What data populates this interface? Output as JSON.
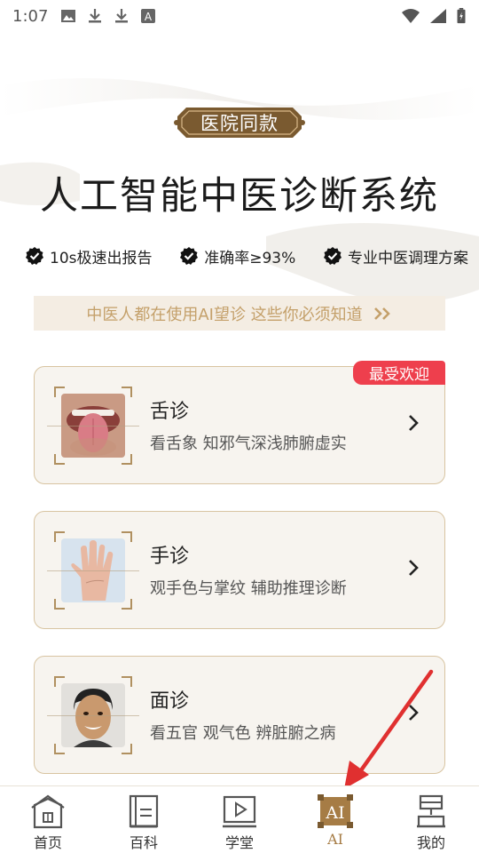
{
  "status_bar": {
    "time": "1:07",
    "left_icons": [
      "image-icon",
      "download-icon",
      "download-icon",
      "font-icon"
    ],
    "right_icons": [
      "wifi-icon",
      "signal-icon",
      "battery-icon"
    ]
  },
  "header": {
    "badge": "医院同款",
    "title": "人工智能中医诊断系统",
    "features": [
      {
        "icon": "check-icon",
        "label": "10s极速出报告"
      },
      {
        "icon": "check-icon",
        "label": "准确率≥93%"
      },
      {
        "icon": "check-icon",
        "label": "专业中医调理方案"
      }
    ]
  },
  "notice": {
    "text": "中医人都在使用AI望诊 这些你必须知道",
    "arrow": "》"
  },
  "cards": [
    {
      "title": "舌诊",
      "desc": "看舌象 知邪气深浅肺腑虚实",
      "ribbon": "最受欢迎",
      "image": "tongue-photo"
    },
    {
      "title": "手诊",
      "desc": "观手色与掌纹 辅助推理诊断",
      "image": "hand-photo"
    },
    {
      "title": "面诊",
      "desc": "看五官 观气色 辨脏腑之病",
      "image": "face-photo"
    }
  ],
  "tab_bar": {
    "active": "AI",
    "tabs": [
      {
        "label": "首页",
        "icon": "home-icon"
      },
      {
        "label": "百科",
        "icon": "book-icon"
      },
      {
        "label": "学堂",
        "icon": "video-icon"
      },
      {
        "label": "AI",
        "icon": "ai-icon"
      },
      {
        "label": "我的",
        "icon": "profile-icon"
      }
    ]
  },
  "colors": {
    "accent": "#a67c45",
    "badge_bg": "#7a5a30",
    "ribbon": "#ee3f4d",
    "notice_text": "#c4a06a",
    "card_border": "#d8c4a1",
    "annotation_arrow": "#e03030"
  }
}
